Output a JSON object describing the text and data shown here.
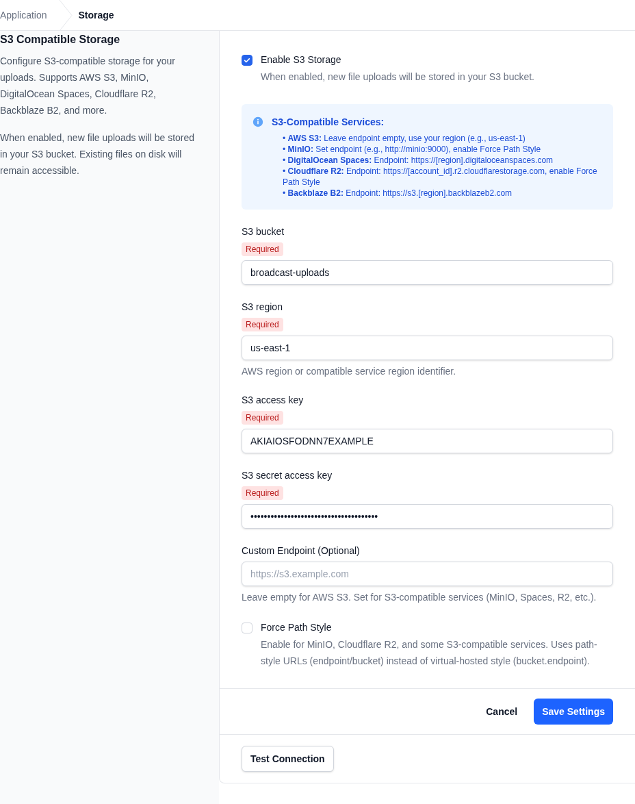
{
  "breadcrumb": [
    {
      "label": "Application",
      "selected": false
    },
    {
      "label": "Storage",
      "selected": true
    }
  ],
  "sidebar": {
    "title": "S3 Compatible Storage",
    "paragraphs": [
      "Configure S3-compatible storage for your uploads. Supports AWS S3, MinIO, DigitalOcean Spaces, Cloudflare R2, Backblaze B2, and more.",
      "When enabled, new file uploads will be stored in your S3 bucket. Existing files on disk will remain accessible."
    ]
  },
  "enable": {
    "label": "Enable S3 Storage",
    "description": "When enabled, new file uploads will be stored in your S3 bucket.",
    "checked": true
  },
  "info": {
    "title": "S3-Compatible Services:",
    "items": [
      "•  **AWS S3:** Leave endpoint empty, use your region (e.g., us-east-1)",
      "•  **MinIO:** Set endpoint (e.g., http://minio:9000), enable Force Path Style",
      "•  **DigitalOcean Spaces:** Endpoint: https://[region].digitaloceanspaces.com",
      "•  **Cloudflare R2:** Endpoint: https://[account_id].r2.cloudflarestorage.com, enable Force Path Style",
      "•  **Backblaze B2:** Endpoint: https://s3.[region].backblazeb2.com"
    ]
  },
  "fields": [
    {
      "label": "S3 bucket",
      "badge": "Required",
      "value": "broadcast-uploads"
    },
    {
      "label": "S3 region",
      "badge": "Required",
      "value": "us-east-1",
      "hint": "AWS region or compatible service region identifier."
    },
    {
      "label": "S3 access key",
      "badge": "Required",
      "value": "AKIAIOSFODNN7EXAMPLE"
    },
    {
      "label": "S3 secret access key",
      "badge": "Required",
      "value": "••••••••••••••••••••••••••••••••••••••"
    },
    {
      "label": "Custom Endpoint (Optional)",
      "placeholder": "https://s3.example.com",
      "hint": "Leave empty for AWS S3. Set for S3-compatible services (MinIO, Spaces, R2, etc.)."
    }
  ],
  "force_path": {
    "label": "Force Path Style",
    "description": "Enable for MinIO, Cloudflare R2, and some S3-compatible services. Uses path-style URLs (endpoint/bucket) instead of virtual-hosted style (bucket.endpoint).",
    "checked": false
  },
  "actions": {
    "cancel": "Cancel",
    "save": "Save Settings"
  },
  "test_button": "Test Connection"
}
